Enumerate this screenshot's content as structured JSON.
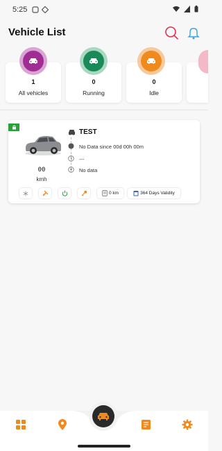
{
  "status_bar": {
    "time": "5:25"
  },
  "header": {
    "title": "Vehicle List"
  },
  "stats": [
    {
      "count": "1",
      "label": "All vehicles",
      "color": "#a12c93",
      "ring": "#d9a3d3"
    },
    {
      "count": "0",
      "label": "Running",
      "color": "#1b8a5a",
      "ring": "#a8d8c0"
    },
    {
      "count": "0",
      "label": "Idle",
      "color": "#f08a1c",
      "ring": "#f7c99c"
    }
  ],
  "vehicle": {
    "name": "TEST",
    "speed_value": "00",
    "speed_unit": "kmh",
    "status_text": "No Data since  00d 00h 00m",
    "middle_text": "---",
    "location_text": "No data",
    "distance": "0 km",
    "validity": "364 Days Validity"
  },
  "colors": {
    "accent": "#f08a1c",
    "dark": "#2a2a2a",
    "green": "#2e9f3d"
  },
  "nav": {
    "items": [
      "dashboard-icon",
      "location-icon",
      "vehicle-icon",
      "report-icon",
      "settings-icon"
    ]
  }
}
